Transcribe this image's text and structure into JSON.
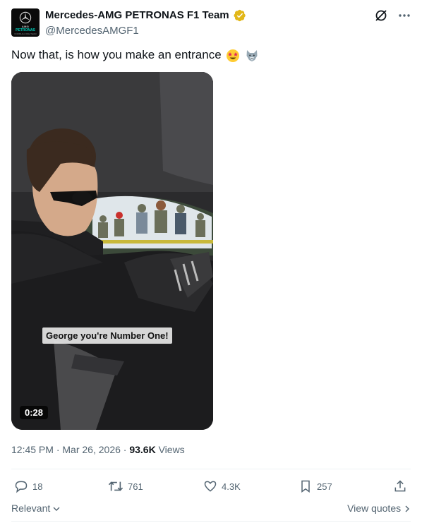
{
  "author": {
    "display_name": "Mercedes-AMG PETRONAS F1 Team",
    "handle": "@MercedesAMGF1",
    "avatar_text": {
      "amg": "AMG",
      "petronas": "PETRONAS",
      "f1": "FORMULA ONE TEAM"
    }
  },
  "tweet": {
    "text": "Now that, is how you make an entrance",
    "emojis": [
      "star-struck-emoji",
      "wolf-emoji"
    ]
  },
  "media": {
    "caption": "George you're Number One!",
    "duration": "0:28"
  },
  "meta": {
    "time": "12:45 PM",
    "separator": " · ",
    "date": "Mar 26, 2026",
    "views_count": "93.6K",
    "views_label": " Views"
  },
  "actions": {
    "replies": "18",
    "reposts": "761",
    "likes": "4.3K",
    "bookmarks": "257"
  },
  "footer": {
    "sort_label": "Relevant",
    "view_quotes": "View quotes"
  },
  "colors": {
    "text_primary": "#0f1419",
    "text_secondary": "#536471",
    "verified_gold": "#e2b719",
    "divider": "#eff3f4"
  }
}
